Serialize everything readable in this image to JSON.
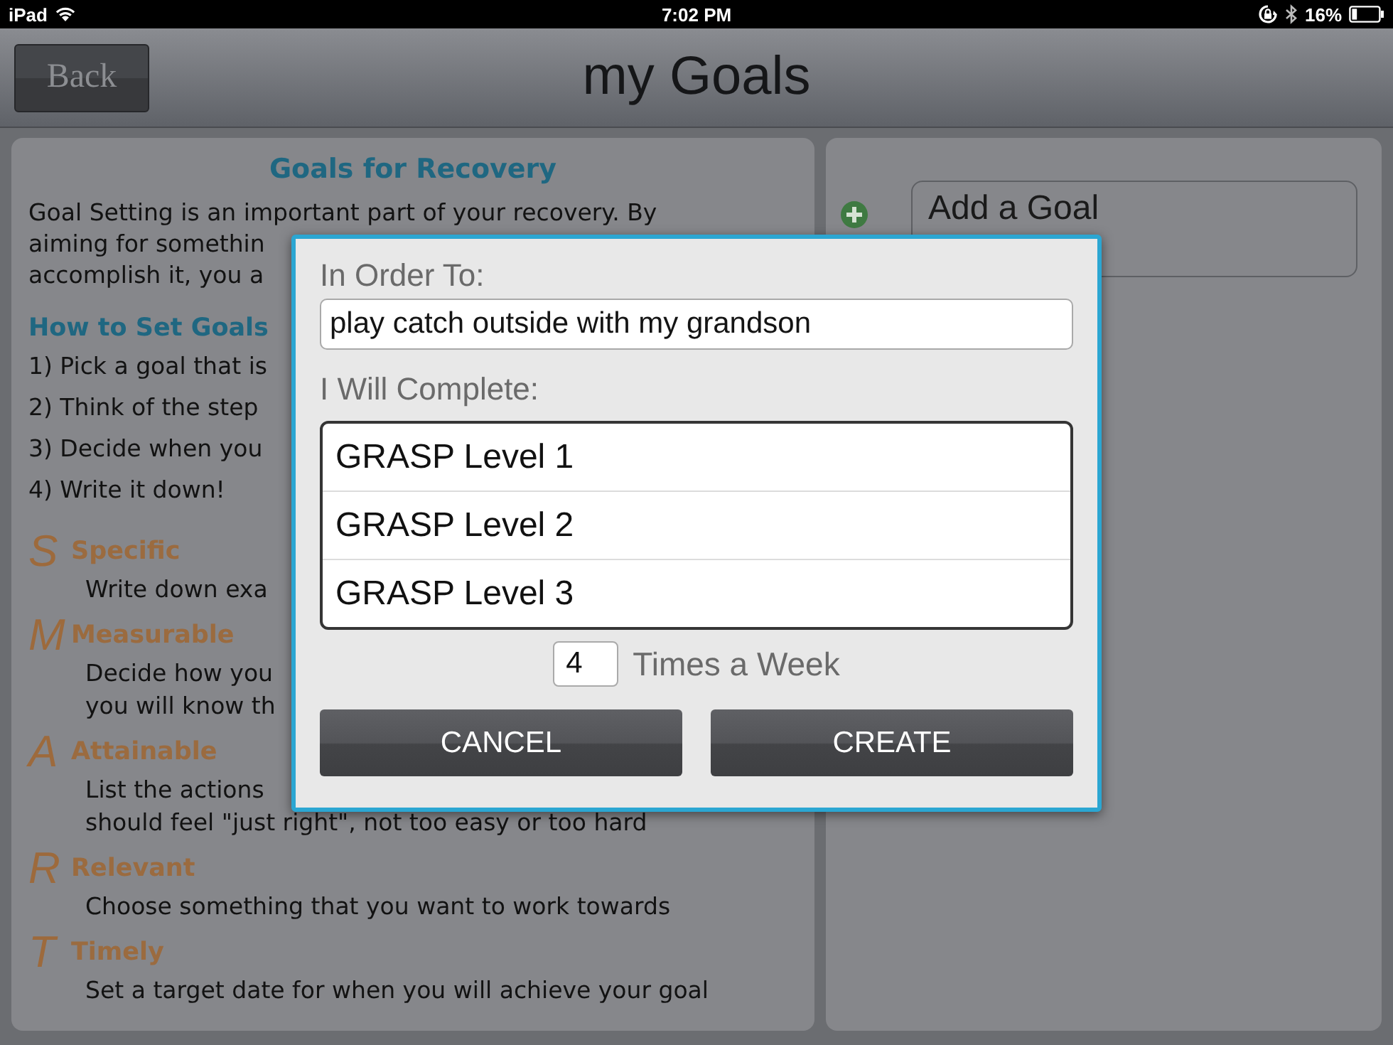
{
  "status_bar": {
    "device": "iPad",
    "time": "7:02 PM",
    "battery": "16%"
  },
  "nav": {
    "back_button": "Back",
    "title": "my Goals"
  },
  "guide": {
    "heading": "Goals for Recovery",
    "intro_lines": [
      "Goal Setting is an important part of your recovery. By",
      "aiming for somethin",
      "accomplish it, you a"
    ],
    "subheading": "How to Set Goals",
    "steps": [
      "1) Pick a goal that is",
      "2) Think of the step",
      "3) Decide when you",
      "4) Write it down!"
    ],
    "smart": [
      {
        "letter": "S",
        "title": "Specific",
        "lines": [
          "Write down exa"
        ]
      },
      {
        "letter": "M",
        "title": "Measurable",
        "lines": [
          "Decide how you",
          "you will know th"
        ]
      },
      {
        "letter": "A",
        "title": "Attainable",
        "lines": [
          "List the actions",
          "should feel \"just right\", not too easy or too hard"
        ]
      },
      {
        "letter": "R",
        "title": "Relevant",
        "lines": [
          "Choose something that you want to work towards"
        ]
      },
      {
        "letter": "T",
        "title": "Timely",
        "lines": [
          "Set a target date for when you will achieve your goal"
        ]
      }
    ]
  },
  "goals_panel": {
    "add_goal": "Add a Goal"
  },
  "dialog": {
    "order_label": "In Order To:",
    "order_value": "play catch outside with my grandson",
    "complete_label": "I Will Complete:",
    "options": [
      {
        "label": "GRASP Level 1",
        "selected": false
      },
      {
        "label": "GRASP Level 2",
        "selected": false
      },
      {
        "label": "GRASP Level 3",
        "selected": false
      }
    ],
    "times_value": "4",
    "times_label": "Times a Week",
    "buttons": [
      {
        "label": "CANCEL"
      },
      {
        "label": "CREATE"
      }
    ]
  }
}
